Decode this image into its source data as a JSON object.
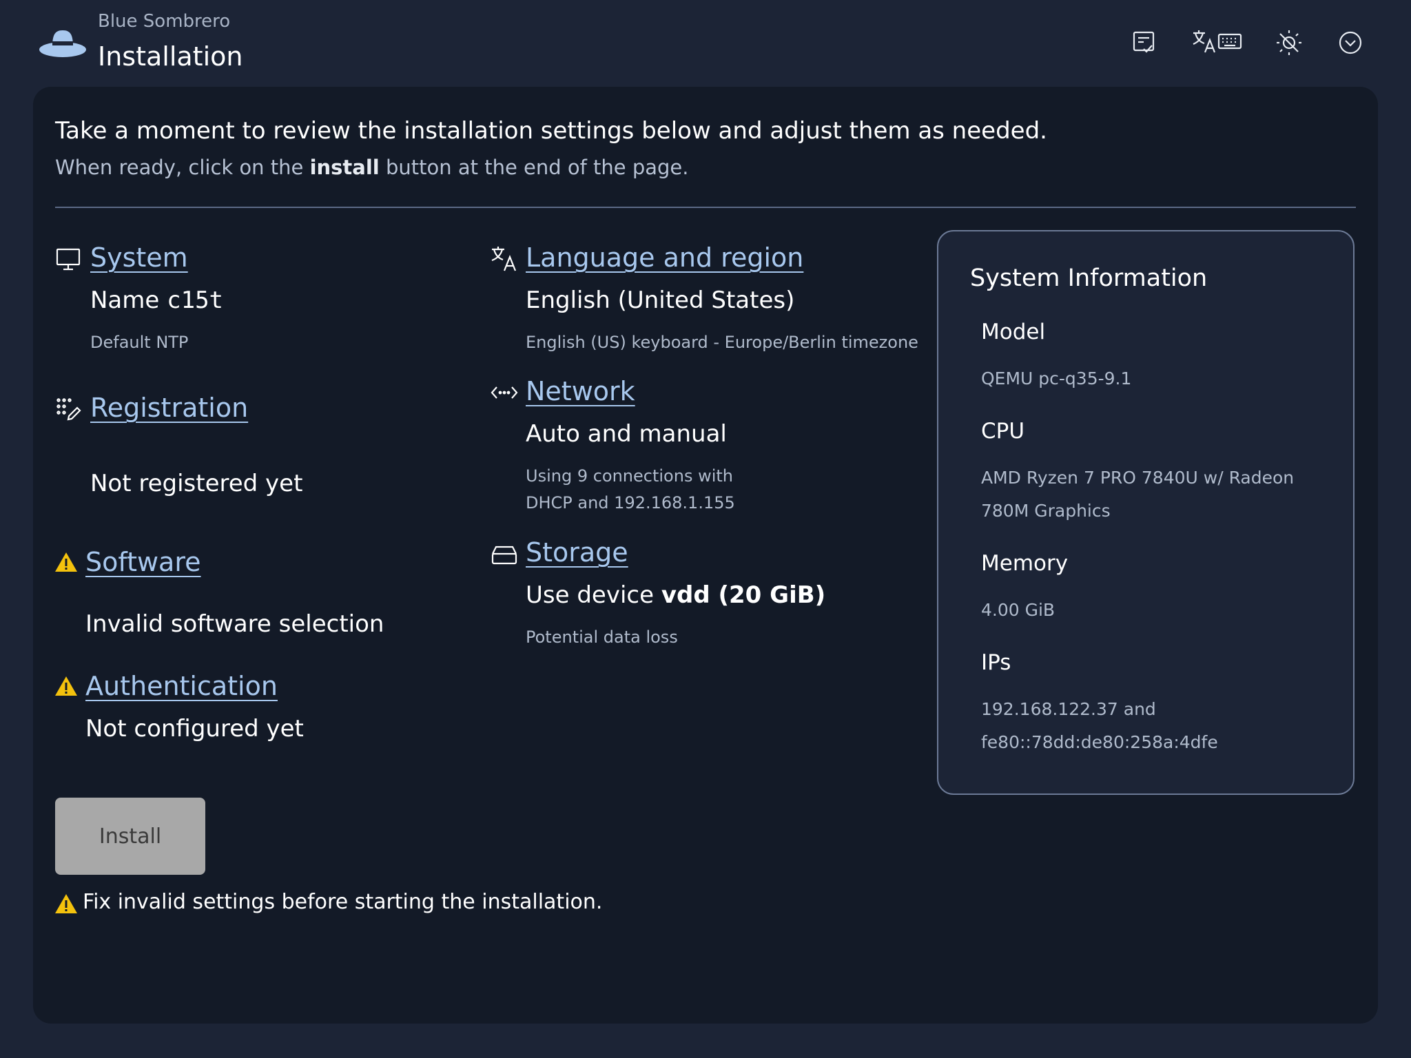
{
  "header": {
    "brand": "Blue Sombrero",
    "title": "Installation"
  },
  "toolbar": {
    "icons": [
      "checklist-icon",
      "language-icon",
      "keyboard-icon",
      "brightness-icon",
      "dropdown-icon"
    ]
  },
  "intro": {
    "line1": "Take a moment to review the installation settings below and adjust them as needed.",
    "line2_prefix": "When ready, click on the ",
    "line2_bold": "install",
    "line2_suffix": " button at the end of the page."
  },
  "sections": {
    "system": {
      "title": "System",
      "value_prefix": "Name ",
      "hostname": "c15t",
      "detail": "Default NTP"
    },
    "registration": {
      "title": "Registration",
      "value": "Not registered yet"
    },
    "software": {
      "title": "Software",
      "value": "Invalid software selection",
      "status": "warning"
    },
    "authentication": {
      "title": "Authentication",
      "value": "Not configured yet",
      "status": "warning"
    },
    "language": {
      "title": "Language and region",
      "value": "English (United States)",
      "detail": "English (US) keyboard - Europe/Berlin timezone"
    },
    "network": {
      "title": "Network",
      "value": "Auto and manual",
      "detail_line1": "Using 9 connections with",
      "detail_line2": "DHCP and 192.168.1.155"
    },
    "storage": {
      "title": "Storage",
      "value_prefix": "Use device ",
      "value_bold": "vdd (20 GiB)",
      "detail": "Potential data loss"
    }
  },
  "system_information": {
    "title": "System Information",
    "model_label": "Model",
    "model_value": "QEMU pc-q35-9.1",
    "cpu_label": "CPU",
    "cpu_value_line1": "AMD Ryzen 7 PRO 7840U w/ Radeon",
    "cpu_value_line2": "780M Graphics",
    "memory_label": "Memory",
    "memory_value": "4.00 GiB",
    "ips_label": "IPs",
    "ips_value_line1": "192.168.122.37 and",
    "ips_value_line2": "fe80::78dd:de80:258a:4dfe"
  },
  "install": {
    "button_label": "Install",
    "disabled": true,
    "warning": "Fix invalid settings before starting the installation."
  },
  "colors": {
    "background": "#1c2436",
    "card": "#131a27",
    "link": "#a8c8ee",
    "warning": "#f4c20d",
    "button_disabled": "#a8a8a8"
  }
}
